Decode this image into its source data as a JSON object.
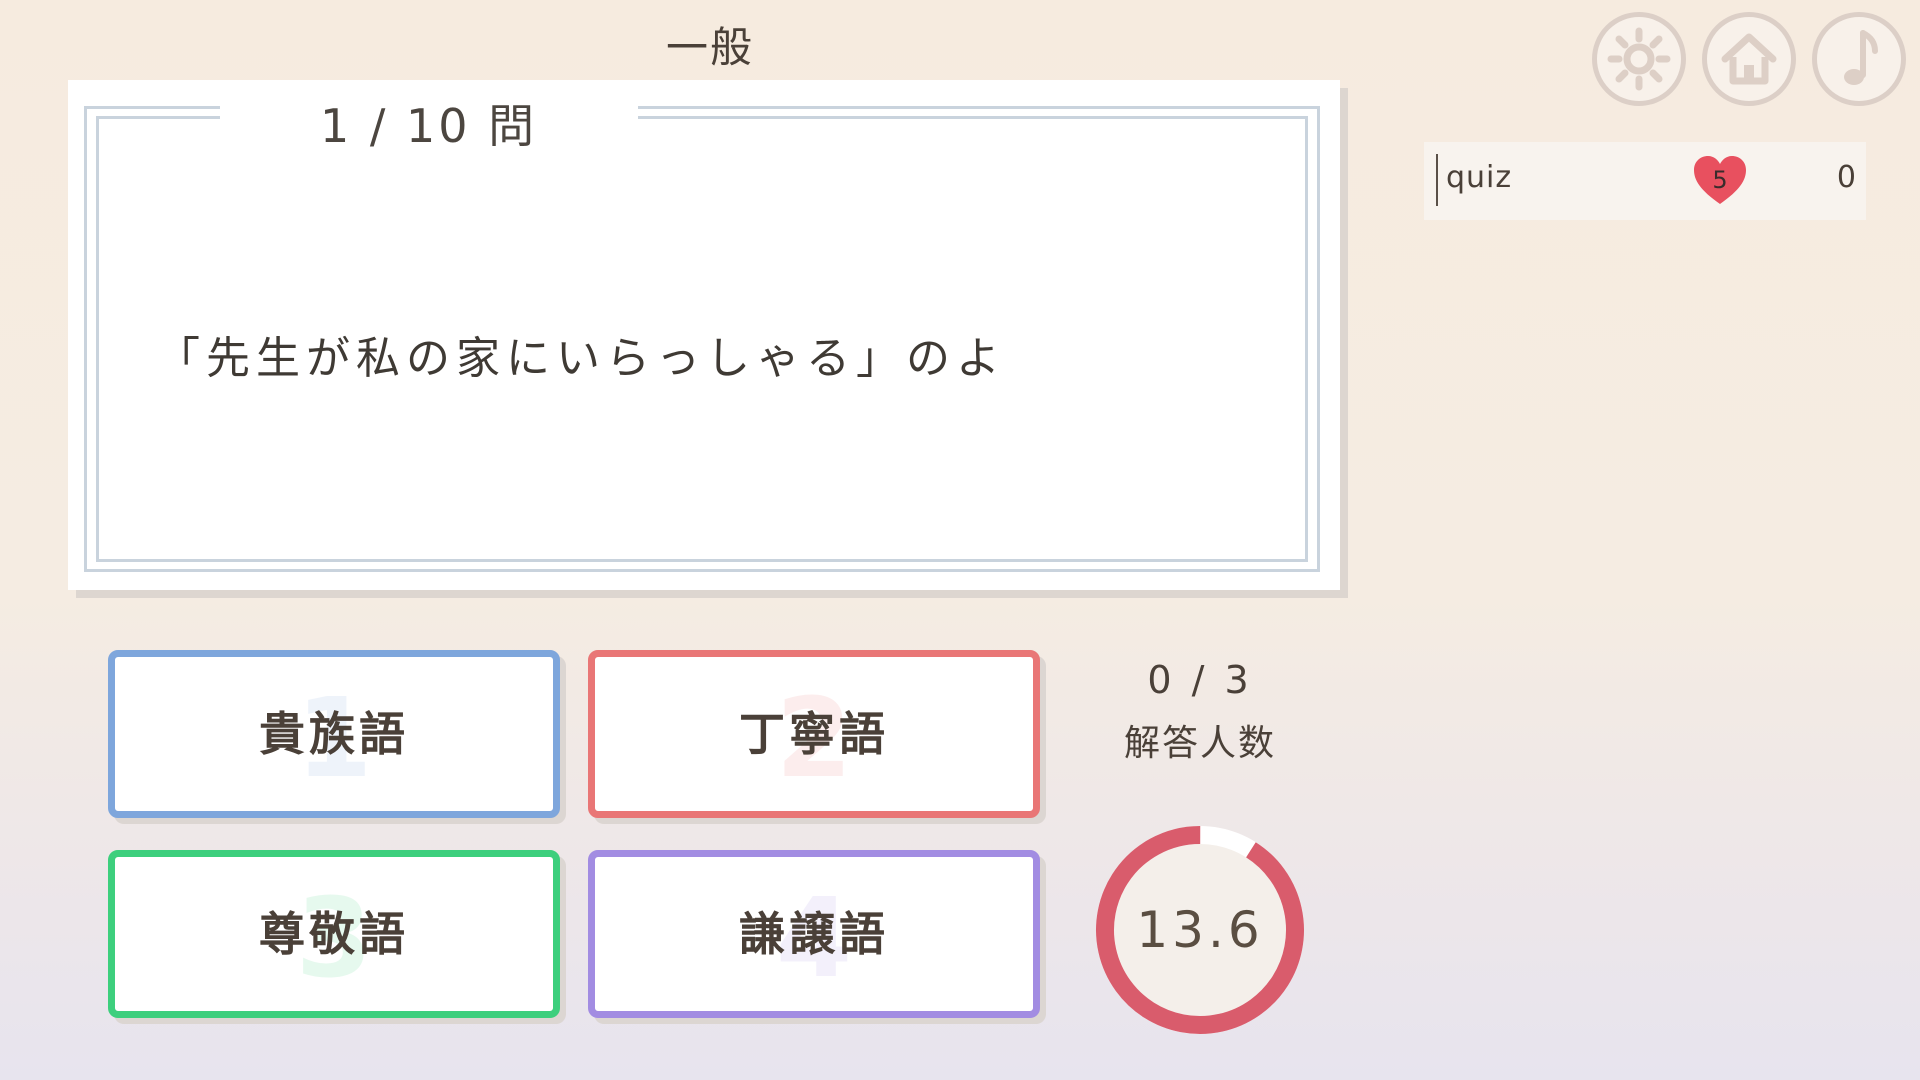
{
  "header": {
    "category": "一般"
  },
  "question": {
    "counter": "1 / 10 問",
    "text": "「先生が私の家にいらっしゃる」のよ"
  },
  "answers": [
    {
      "number": "1",
      "label": "貴族語",
      "color": "#7ea6dc"
    },
    {
      "number": "2",
      "label": "丁寧語",
      "color": "#e97676"
    },
    {
      "number": "3",
      "label": "尊敬語",
      "color": "#3dcf7d"
    },
    {
      "number": "4",
      "label": "謙譲語",
      "color": "#a28ce2"
    }
  ],
  "status": {
    "answered": "0 / 3",
    "answered_label": "解答人数"
  },
  "timer": {
    "value": "13.6",
    "remaining_fraction": 0.91,
    "ring_color": "#d95c6c"
  },
  "toolbar": {
    "icons": [
      "gear-icon",
      "home-icon",
      "music-note-icon"
    ]
  },
  "player": {
    "name": "quiz",
    "lives": "5",
    "score": "0",
    "heart_color": "#e8505f"
  }
}
